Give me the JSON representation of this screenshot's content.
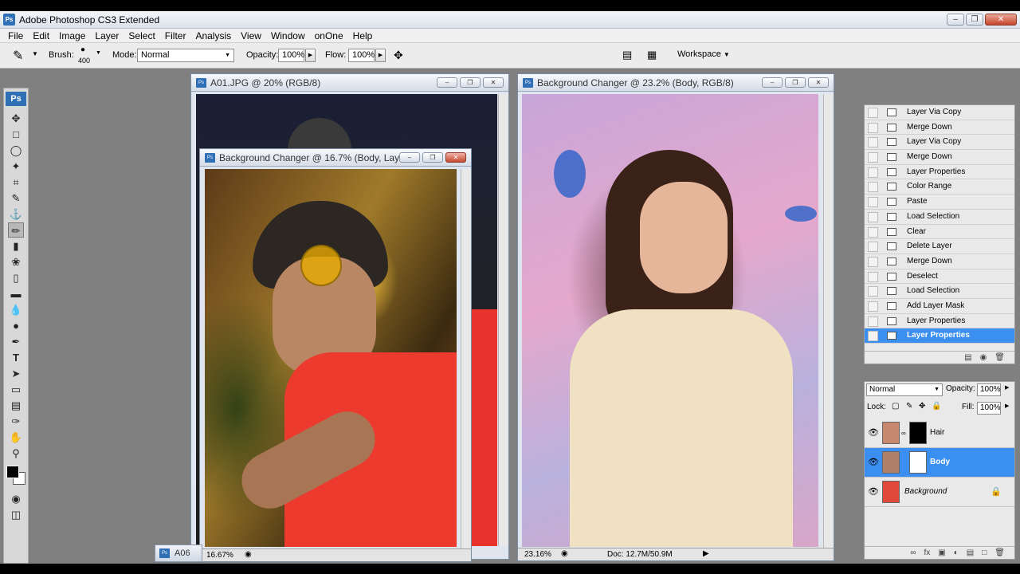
{
  "app": {
    "title": "Adobe Photoshop CS3 Extended",
    "logo": "Ps"
  },
  "menu": [
    "File",
    "Edit",
    "Image",
    "Layer",
    "Select",
    "Filter",
    "Analysis",
    "View",
    "Window",
    "onOne",
    "Help"
  ],
  "options": {
    "brush_label": "Brush:",
    "brush_size": "400",
    "mode_label": "Mode:",
    "mode_value": "Normal",
    "opacity_label": "Opacity:",
    "opacity_value": "100%",
    "flow_label": "Flow:",
    "flow_value": "100%",
    "workspace_label": "Workspace"
  },
  "documents": {
    "a01": {
      "title": "A01.JPG @ 20% (RGB/8)"
    },
    "man": {
      "title": "Background Changer @ 16.7% (Body, Lay...",
      "zoom": "16.67%"
    },
    "woman": {
      "title": "Background Changer @ 23.2% (Body, RGB/8)",
      "zoom": "23.16%",
      "doc_info": "Doc: 12.7M/50.9M"
    },
    "minimized": {
      "label": "A06"
    }
  },
  "history": {
    "items": [
      "Layer Via Copy",
      "Merge Down",
      "Layer Via Copy",
      "Merge Down",
      "Layer Properties",
      "Color Range",
      "Paste",
      "Load Selection",
      "Clear",
      "Delete Layer",
      "Merge Down",
      "Deselect",
      "Load Selection",
      "Add Layer Mask",
      "Layer Properties",
      "Layer Properties"
    ]
  },
  "layers": {
    "blend_mode": "Normal",
    "opacity_label": "Opacity:",
    "opacity_value": "100%",
    "lock_label": "Lock:",
    "fill_label": "Fill:",
    "fill_value": "100%",
    "items": [
      {
        "name": "Hair"
      },
      {
        "name": "Body"
      },
      {
        "name": "Background"
      }
    ]
  },
  "colors": {
    "accent": "#3a8ff0",
    "brand": "#2f6fb5"
  }
}
